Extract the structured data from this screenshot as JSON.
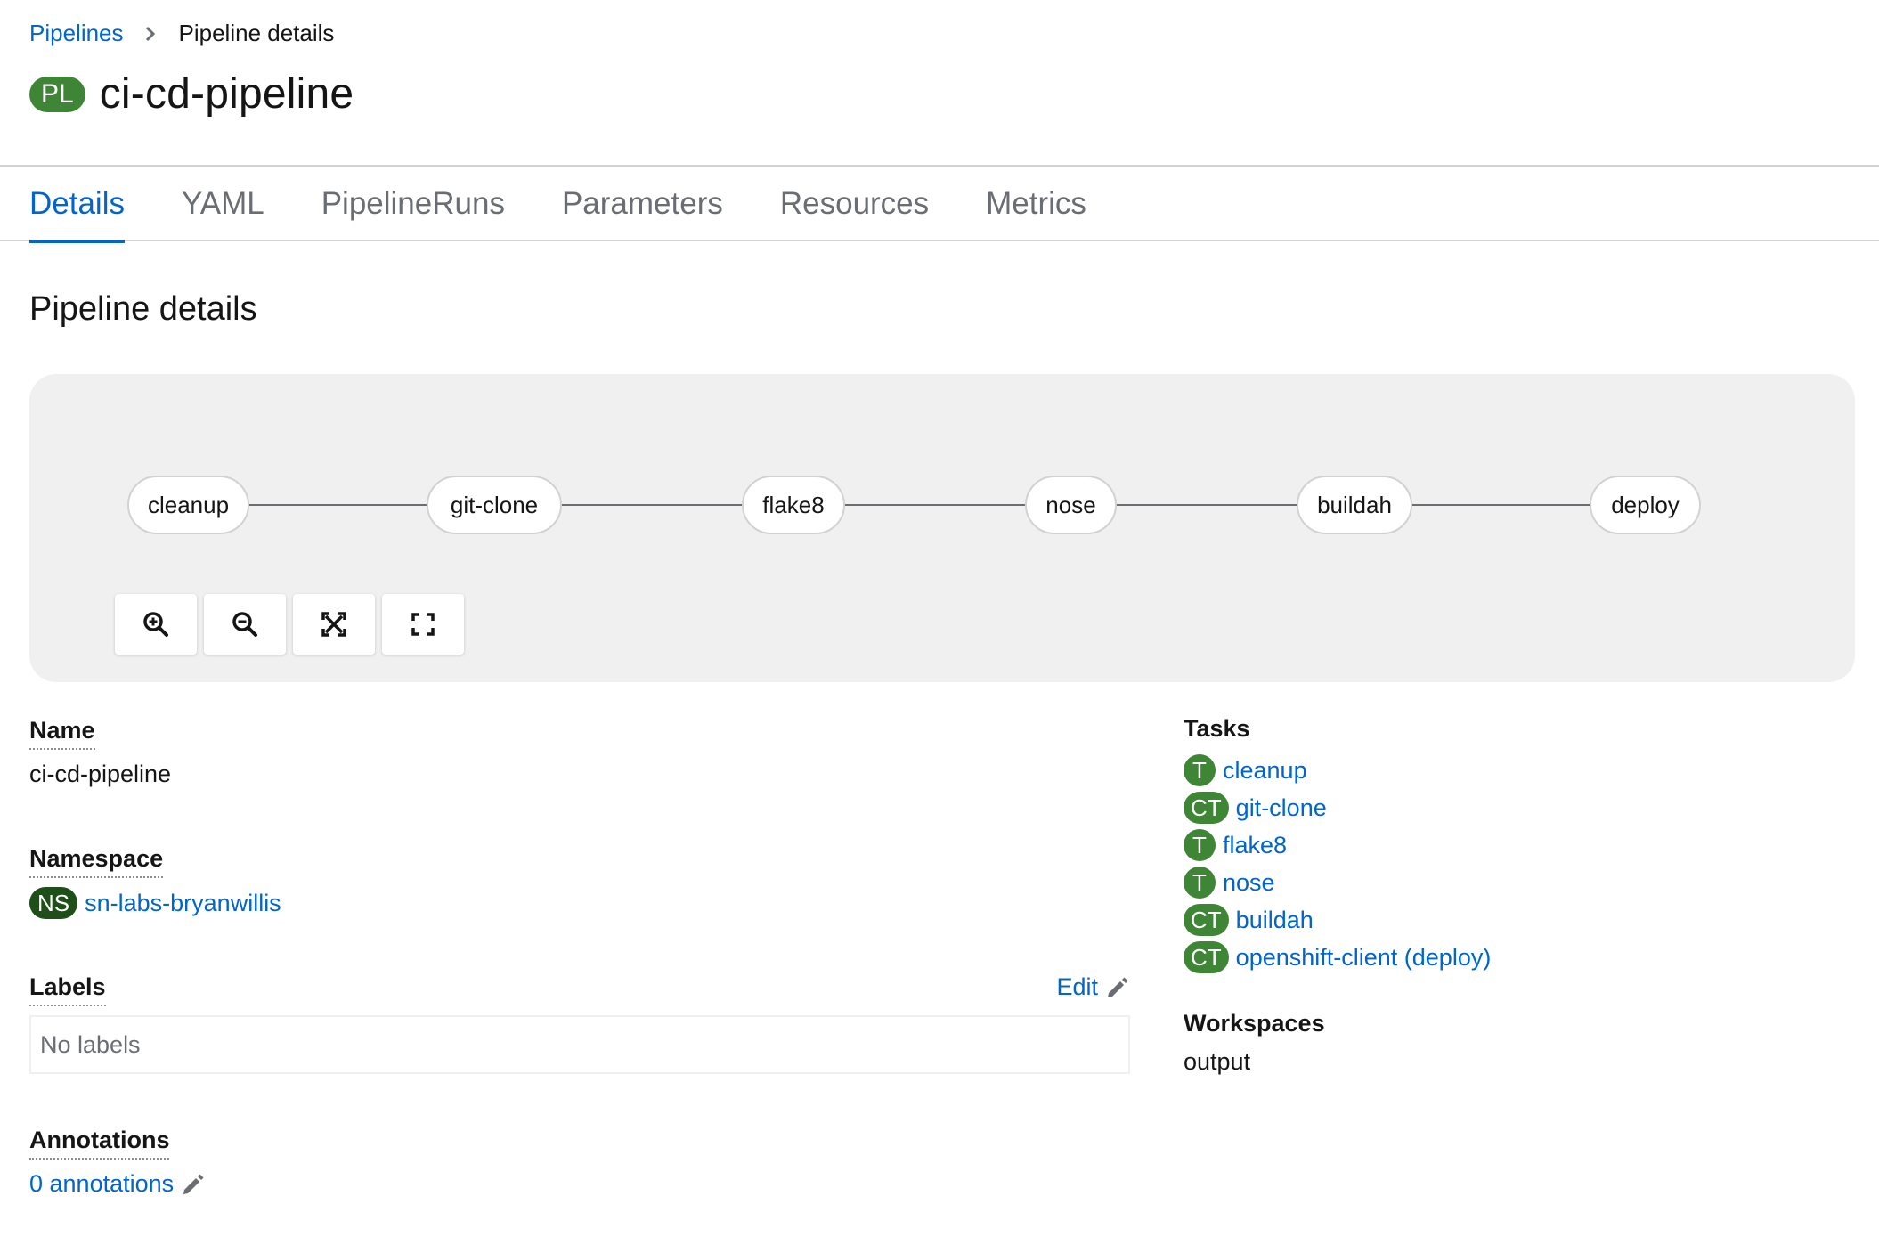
{
  "breadcrumb": {
    "parent": "Pipelines",
    "current": "Pipeline details"
  },
  "header": {
    "badge": "PL",
    "title": "ci-cd-pipeline"
  },
  "tabs": [
    {
      "label": "Details",
      "active": true
    },
    {
      "label": "YAML"
    },
    {
      "label": "PipelineRuns"
    },
    {
      "label": "Parameters"
    },
    {
      "label": "Resources"
    },
    {
      "label": "Metrics"
    }
  ],
  "section_title": "Pipeline details",
  "topology": {
    "nodes": [
      "cleanup",
      "git-clone",
      "flake8",
      "nose",
      "buildah",
      "deploy"
    ],
    "controls": [
      {
        "name": "zoom-in-icon"
      },
      {
        "name": "zoom-out-icon"
      },
      {
        "name": "fit-to-screen-icon"
      },
      {
        "name": "expand-icon"
      }
    ]
  },
  "details": {
    "name_label": "Name",
    "name_value": "ci-cd-pipeline",
    "namespace_label": "Namespace",
    "namespace_badge": "NS",
    "namespace_value": "sn-labs-bryanwillis",
    "labels_label": "Labels",
    "labels_edit": "Edit",
    "labels_empty": "No labels",
    "annotations_label": "Annotations",
    "annotations_value": "0 annotations"
  },
  "tasks": {
    "label": "Tasks",
    "items": [
      {
        "badge": "T",
        "name": "cleanup"
      },
      {
        "badge": "CT",
        "name": "git-clone"
      },
      {
        "badge": "T",
        "name": "flake8"
      },
      {
        "badge": "T",
        "name": "nose"
      },
      {
        "badge": "CT",
        "name": "buildah"
      },
      {
        "badge": "CT",
        "name": "openshift-client (deploy)"
      }
    ]
  },
  "workspaces": {
    "label": "Workspaces",
    "value": "output"
  },
  "colors": {
    "link": "#0066cc",
    "badge_green": "#3e8635",
    "ns_badge": "#1e4f18",
    "panel_bg": "#f0f0f0"
  }
}
